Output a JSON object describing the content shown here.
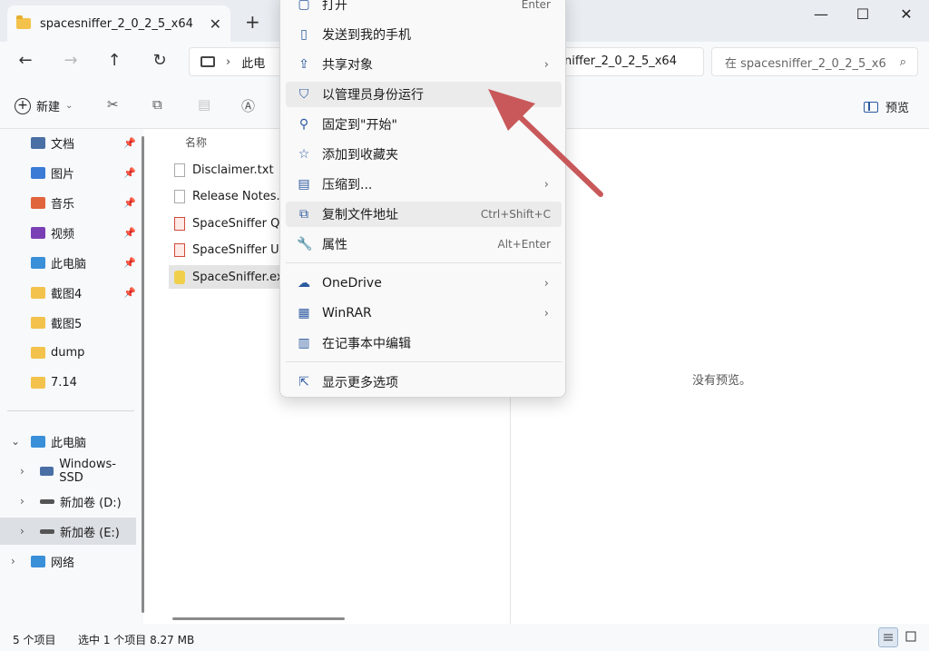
{
  "window": {
    "tab_title": "spacesniffer_2_0_2_5_x64",
    "tab_close": "✕",
    "new_tab": "+",
    "minimize": "—",
    "maximize": "☐",
    "close": "✕"
  },
  "nav": {
    "back": "←",
    "forward": "→",
    "up": "↑",
    "refresh": "↻",
    "address_prefix": "此电",
    "address_tail": "niffer_2_0_2_5_x64",
    "search_placeholder": "在 spacesniffer_2_0_2_5_x6",
    "search_icon": "⌕"
  },
  "toolbar": {
    "new_label": "新建",
    "preview_label": "预览"
  },
  "sidebar": {
    "quick_access": [
      {
        "label": "文档",
        "icon": "document-icon",
        "color": "#4a6fa5"
      },
      {
        "label": "图片",
        "icon": "pictures-icon",
        "color": "#3a7bd5"
      },
      {
        "label": "音乐",
        "icon": "music-icon",
        "color": "#e0643c"
      },
      {
        "label": "视频",
        "icon": "video-icon",
        "color": "#7b3fb5"
      },
      {
        "label": "此电脑",
        "icon": "pc-icon",
        "color": "#3a8fd9"
      },
      {
        "label": "截图4",
        "icon": "folder-icon",
        "color": "#f3c24d"
      },
      {
        "label": "截图5",
        "icon": "folder-icon",
        "color": "#f3c24d"
      },
      {
        "label": "dump",
        "icon": "folder-icon",
        "color": "#f3c24d"
      },
      {
        "label": "7.14",
        "icon": "folder-icon",
        "color": "#f3c24d"
      }
    ],
    "this_pc": "此电脑",
    "drives": [
      "Windows-SSD",
      "新加卷 (D:)",
      "新加卷 (E:)"
    ],
    "network": "网络"
  },
  "filelist": {
    "column_name": "名称",
    "files": [
      {
        "name": "Disclaimer.txt",
        "type": "txt"
      },
      {
        "name": "Release Notes.tx",
        "type": "txt"
      },
      {
        "name": "SpaceSniffer Qui",
        "type": "pdf"
      },
      {
        "name": "SpaceSniffer Use",
        "type": "pdf"
      },
      {
        "name": "SpaceSniffer.exe",
        "type": "exe"
      }
    ]
  },
  "preview": {
    "empty_text": "没有预览。"
  },
  "status": {
    "item_count": "5 个项目",
    "selection": "选中 1 个项目  8.27 MB"
  },
  "context_menu": {
    "items": [
      {
        "label": "打开",
        "shortcut": "Enter"
      },
      {
        "label": "发送到我的手机"
      },
      {
        "label": "共享对象",
        "submenu": "›"
      },
      {
        "label": "以管理员身份运行"
      },
      {
        "label": "固定到\"开始\""
      },
      {
        "label": "添加到收藏夹"
      },
      {
        "label": "压缩到...",
        "submenu": "›"
      },
      {
        "label": "复制文件地址",
        "shortcut": "Ctrl+Shift+C"
      },
      {
        "label": "属性",
        "shortcut": "Alt+Enter"
      },
      {
        "label": "OneDrive",
        "submenu": "›"
      },
      {
        "label": "WinRAR",
        "submenu": "›"
      },
      {
        "label": "在记事本中编辑"
      },
      {
        "label": "显示更多选项"
      }
    ]
  },
  "colors": {
    "annotation_arrow": "#c8585a"
  }
}
